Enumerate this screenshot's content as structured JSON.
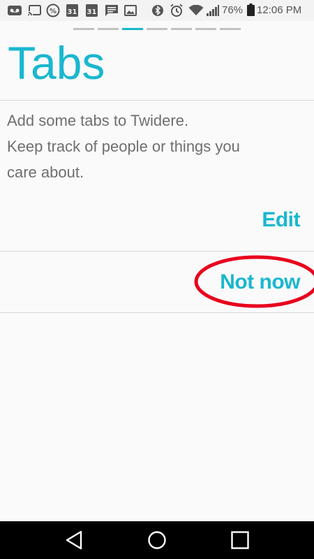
{
  "status_bar": {
    "calendar_day_1": "31",
    "calendar_day_2": "31",
    "battery_percent": "76%",
    "time": "12:06 PM",
    "icons": [
      "voicemail-icon",
      "cast-icon",
      "percent-icon",
      "calendar-icon",
      "calendar-icon",
      "message-icon",
      "image-icon",
      "bluetooth-icon",
      "alarm-icon",
      "wifi-icon",
      "signal-icon",
      "battery-icon"
    ]
  },
  "page_indicator": {
    "count": 7,
    "active_index": 2
  },
  "page": {
    "title": "Tabs",
    "description_lines": [
      "Add some tabs to Twidere.",
      "Keep track of people or things you",
      "care about."
    ],
    "edit_label": "Edit",
    "not_now_label": "Not now"
  },
  "colors": {
    "accent": "#1ab7cf",
    "highlight": "#e8001c",
    "text": "#6f6f6f"
  },
  "nav_bar": {
    "icons": [
      "back-icon",
      "home-icon",
      "recents-icon"
    ]
  }
}
